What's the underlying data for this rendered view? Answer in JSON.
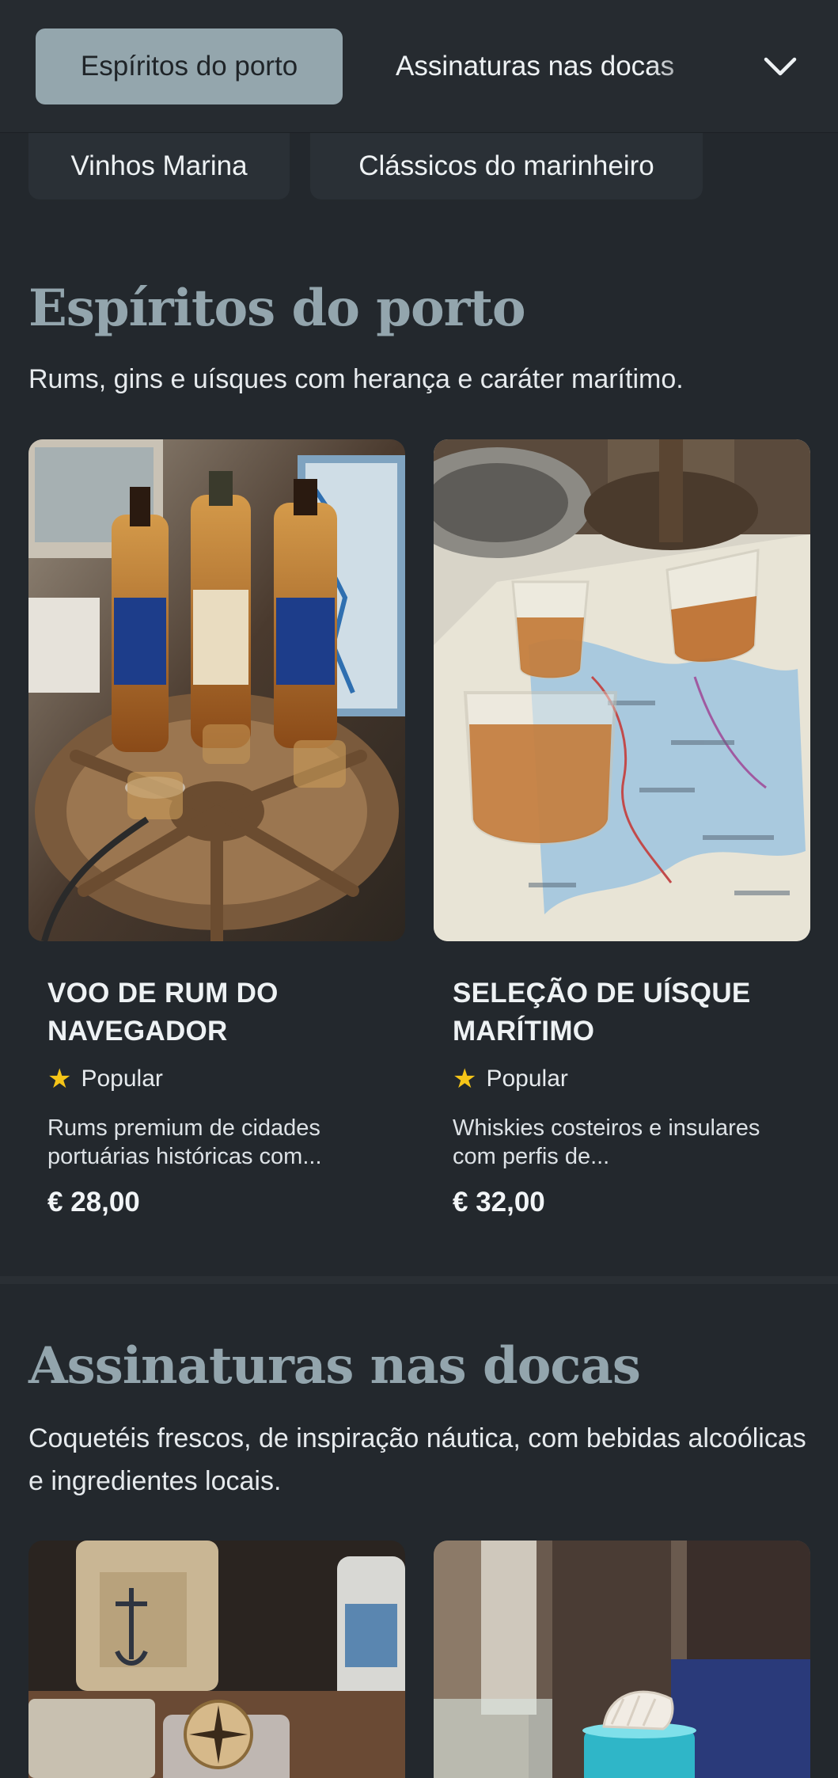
{
  "nav": {
    "tabs": [
      {
        "label": "Espíritos do porto",
        "active": true
      },
      {
        "label": "Assinaturas nas docas",
        "active": false
      }
    ],
    "more_icon": "chevron-down-icon"
  },
  "subnav": {
    "pills": [
      {
        "label": "Vinhos Marina"
      },
      {
        "label": "Clássicos do marinheiro"
      }
    ]
  },
  "sections": [
    {
      "title": "Espíritos do porto",
      "description": "Rums, gins e uísques com herança e caráter marítimo.",
      "items": [
        {
          "name": "VOO DE RUM DO NAVEGADOR",
          "badge": "Popular",
          "badge_icon": "star-icon",
          "description": "Rums premium de cidades portuárias históricas com...",
          "price": "€ 28,00"
        },
        {
          "name": "SELEÇÃO DE UÍSQUE MARÍTIMO",
          "badge": "Popular",
          "badge_icon": "star-icon",
          "description": "Whiskies costeiros e insulares com perfis de...",
          "price": "€ 32,00"
        }
      ]
    },
    {
      "title": "Assinaturas nas docas",
      "description": "Coquetéis frescos, de inspiração náutica, com bebidas alcoólicas e ingredientes locais."
    }
  ],
  "colors": {
    "background": "#23282d",
    "accent": "#93a5ad",
    "active_tab": "#94a6ad",
    "star": "#f5c518"
  }
}
